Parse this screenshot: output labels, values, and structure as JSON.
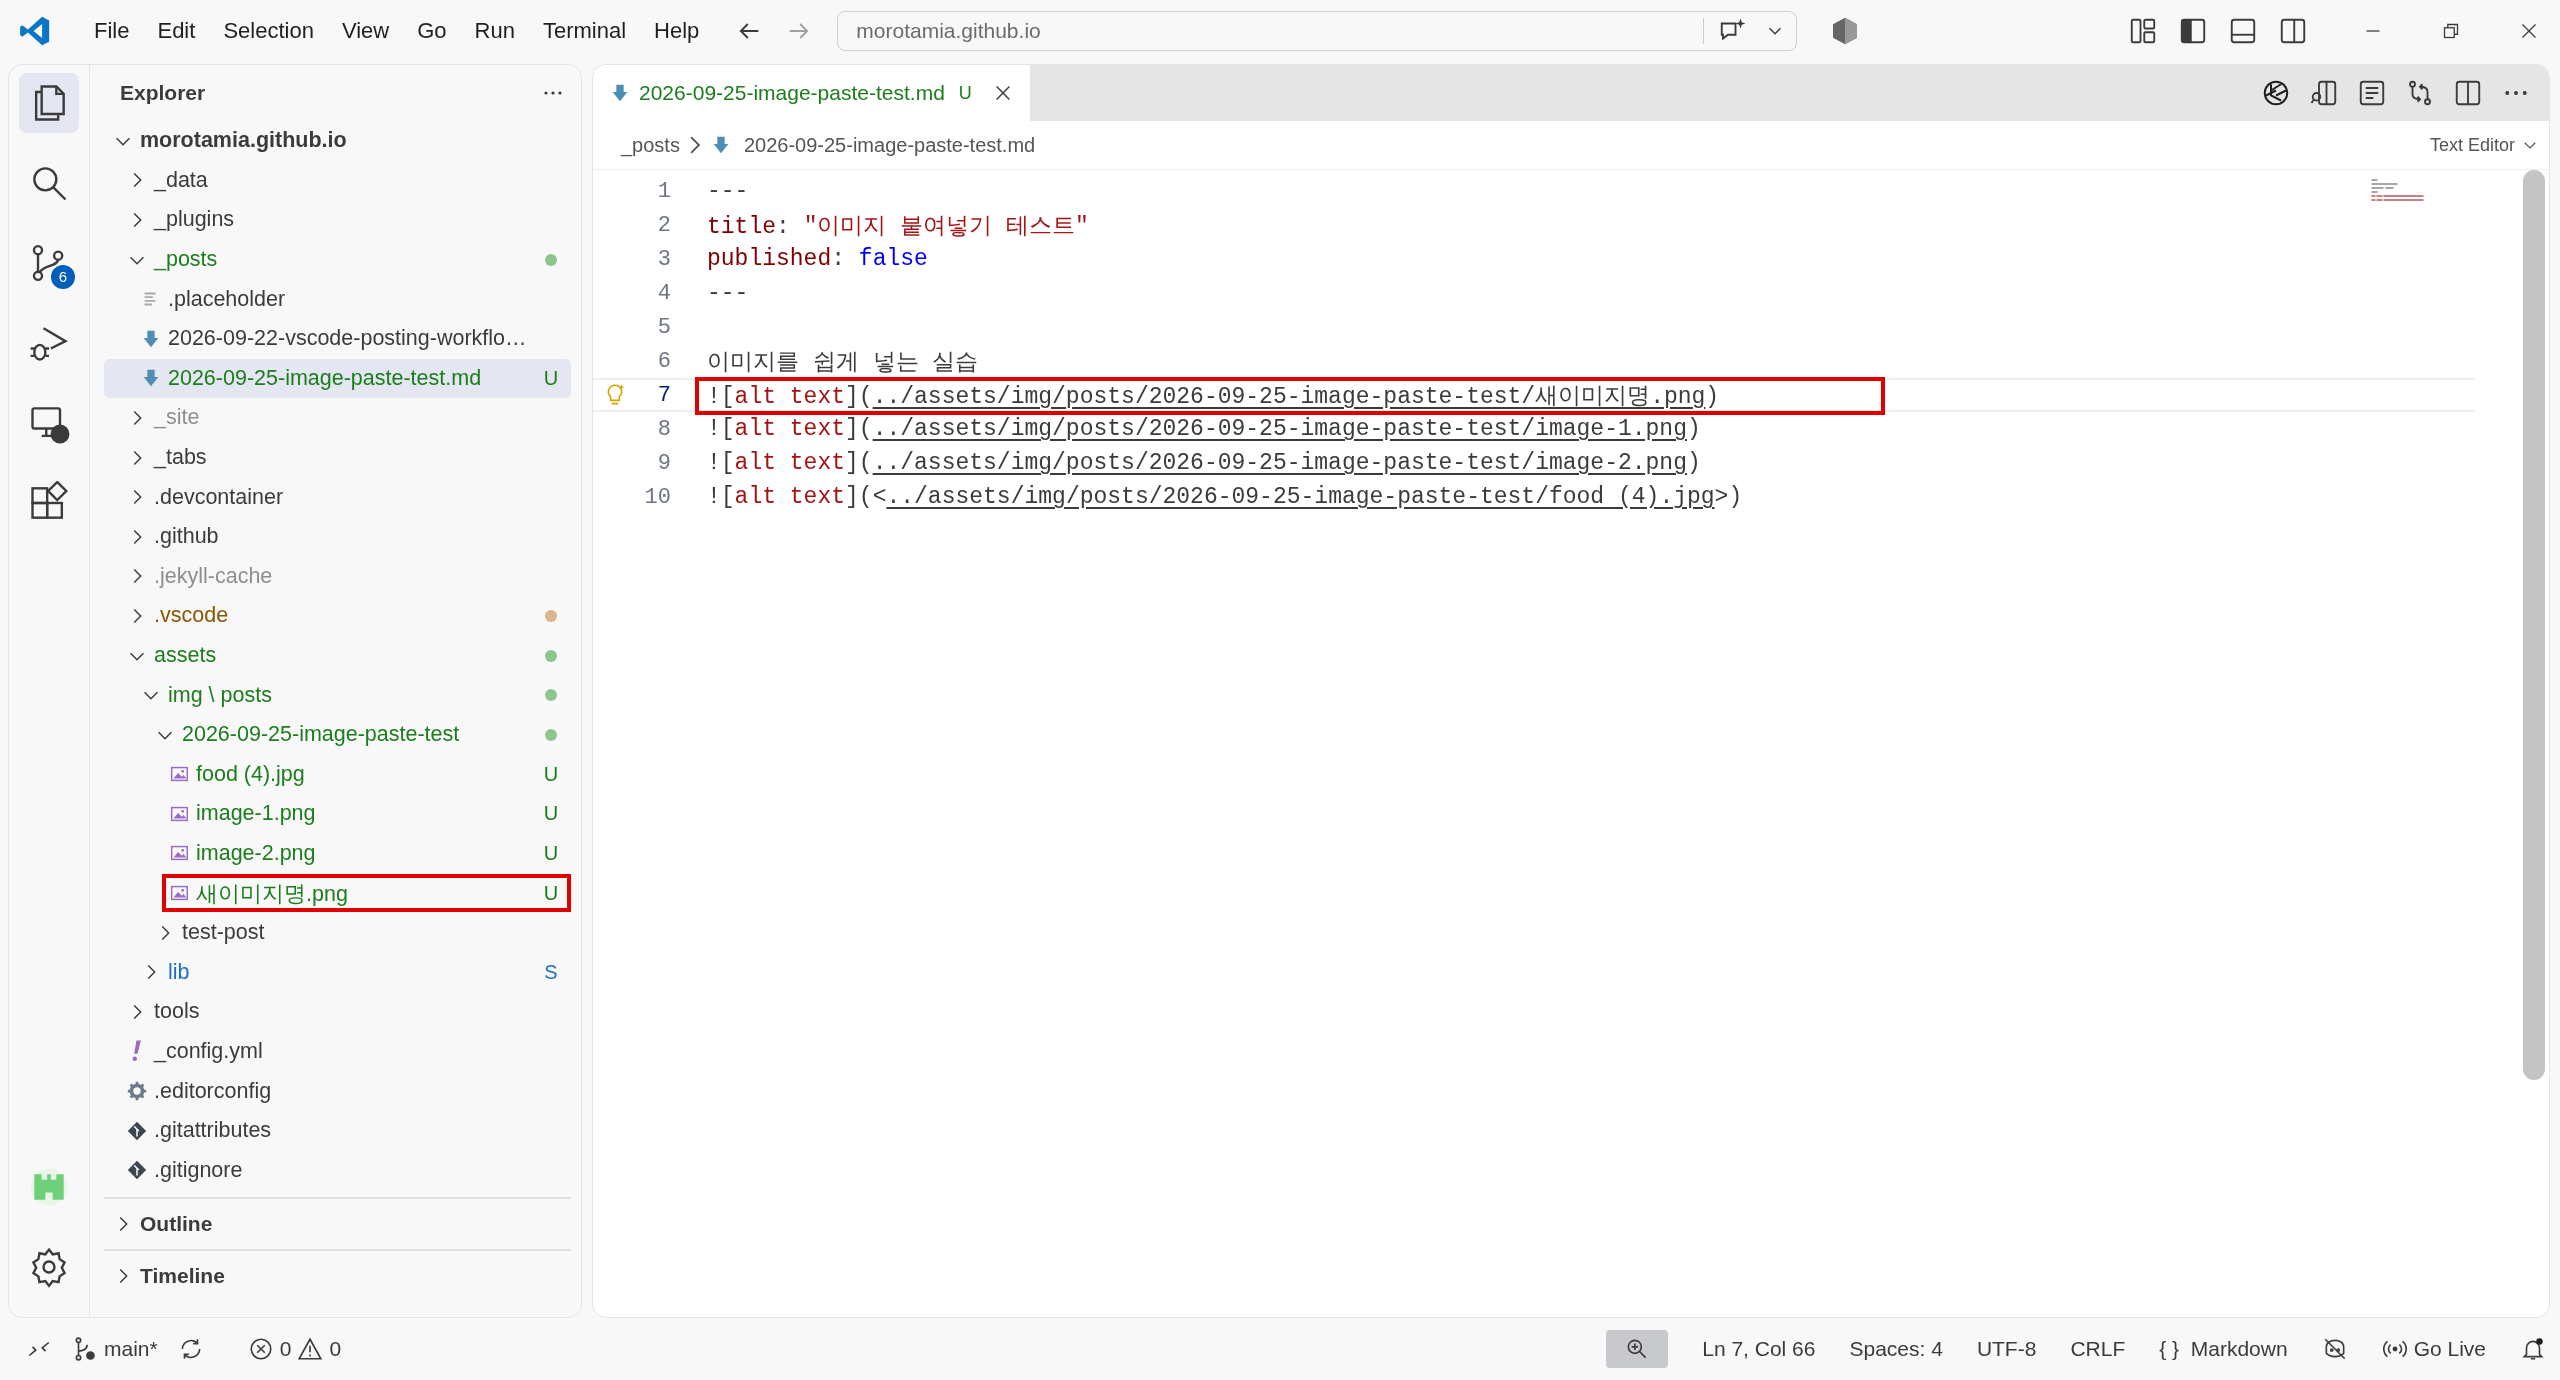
{
  "title_bar": {
    "menus": [
      "File",
      "Edit",
      "Selection",
      "View",
      "Go",
      "Run",
      "Terminal",
      "Help"
    ],
    "command_center": "morotamia.github.io"
  },
  "activity_bar": {
    "top": [
      {
        "kind": "explorer",
        "selected": true
      },
      {
        "kind": "search",
        "selected": false
      },
      {
        "kind": "source-control",
        "selected": false,
        "badge": "6"
      },
      {
        "kind": "run-debug",
        "selected": false
      },
      {
        "kind": "remote",
        "selected": false
      },
      {
        "kind": "extensions",
        "selected": false
      }
    ],
    "bottom": [
      {
        "kind": "extension-app"
      },
      {
        "kind": "settings"
      }
    ]
  },
  "explorer": {
    "title": "Explorer",
    "tree": [
      {
        "name": "morotamia.github.io",
        "kind": "folder",
        "expanded": true,
        "selected": false,
        "color": "#3b3b3b",
        "children": [
          {
            "name": "_data",
            "kind": "folder",
            "expanded": false,
            "selected": false,
            "color": "#3b3b3b"
          },
          {
            "name": "_plugins",
            "kind": "folder",
            "expanded": false,
            "selected": false,
            "color": "#3b3b3b"
          },
          {
            "name": "_posts",
            "kind": "folder",
            "expanded": true,
            "selected": false,
            "color": "#1b7d1b",
            "dot": {
              "color": "#8cc68c"
            },
            "children": [
              {
                "name": ".placeholder",
                "kind": "text",
                "selected": false,
                "color": "#3b3b3b"
              },
              {
                "name": "2026-09-22-vscode-posting-workflo…",
                "kind": "markdown",
                "selected": false,
                "color": "#3b3b3b"
              },
              {
                "name": "2026-09-25-image-paste-test.md",
                "kind": "markdown",
                "selected": true,
                "color": "#1b7d1b",
                "badge": "U"
              }
            ]
          },
          {
            "name": "_site",
            "kind": "folder",
            "expanded": false,
            "selected": false,
            "color": "#8e8e90"
          },
          {
            "name": "_tabs",
            "kind": "folder",
            "expanded": false,
            "selected": false,
            "color": "#3b3b3b"
          },
          {
            "name": ".devcontainer",
            "kind": "folder",
            "expanded": false,
            "selected": false,
            "color": "#3b3b3b"
          },
          {
            "name": ".github",
            "kind": "folder",
            "expanded": false,
            "selected": false,
            "color": "#3b3b3b"
          },
          {
            "name": ".jekyll-cache",
            "kind": "folder",
            "expanded": false,
            "selected": false,
            "color": "#8e8e90"
          },
          {
            "name": ".vscode",
            "kind": "folder",
            "expanded": false,
            "selected": false,
            "color": "#895503",
            "dot": {
              "color": "#d9b48c"
            }
          },
          {
            "name": "assets",
            "kind": "folder",
            "expanded": true,
            "selected": false,
            "color": "#1b7d1b",
            "dot": {
              "color": "#8cc68c"
            },
            "children": [
              {
                "name": "img \\ posts",
                "kind": "folder",
                "expanded": true,
                "selected": false,
                "color": "#1b7d1b",
                "dot": {
                  "color": "#8cc68c"
                },
                "children": [
                  {
                    "name": "2026-09-25-image-paste-test",
                    "kind": "folder",
                    "expanded": true,
                    "selected": false,
                    "color": "#1b7d1b",
                    "dot": {
                      "color": "#8cc68c"
                    },
                    "children": [
                      {
                        "name": "food (4).jpg",
                        "kind": "image",
                        "selected": false,
                        "color": "#1b7d1b",
                        "badge": "U"
                      },
                      {
                        "name": "image-1.png",
                        "kind": "image",
                        "selected": false,
                        "color": "#1b7d1b",
                        "badge": "U"
                      },
                      {
                        "name": "image-2.png",
                        "kind": "image",
                        "selected": false,
                        "color": "#1b7d1b",
                        "badge": "U"
                      },
                      {
                        "name": "새이미지명.png",
                        "kind": "image",
                        "selected": false,
                        "color": "#1b7d1b",
                        "badge": "U",
                        "annotated": true
                      }
                    ]
                  },
                  {
                    "name": "test-post",
                    "kind": "folder",
                    "expanded": false,
                    "selected": false,
                    "color": "#3b3b3b"
                  }
                ]
              },
              {
                "name": "lib",
                "kind": "folder",
                "expanded": false,
                "selected": false,
                "color": "#1a6fc4",
                "badge": "S"
              }
            ]
          },
          {
            "name": "tools",
            "kind": "folder",
            "expanded": false,
            "selected": false,
            "color": "#3b3b3b"
          },
          {
            "name": "_config.yml",
            "kind": "yaml",
            "selected": false,
            "color": "#3b3b3b"
          },
          {
            "name": ".editorconfig",
            "kind": "gear",
            "selected": false,
            "color": "#3b3b3b"
          },
          {
            "name": ".gitattributes",
            "kind": "git",
            "selected": false,
            "color": "#3b3b3b"
          },
          {
            "name": ".gitignore",
            "kind": "git",
            "selected": false,
            "color": "#3b3b3b"
          }
        ]
      }
    ],
    "sections": [
      {
        "label": "Outline",
        "expanded": false
      },
      {
        "label": "Timeline",
        "expanded": false
      }
    ]
  },
  "editor": {
    "tabs": [
      {
        "label": "2026-09-25-image-paste-test.md",
        "badge": "U",
        "selected": true,
        "color": "#1b7d1b"
      }
    ],
    "breadcrumb": [
      {
        "label": "_posts",
        "kind": "folder"
      },
      {
        "label": "2026-09-25-image-paste-test.md",
        "kind": "markdown"
      }
    ],
    "view_mode": "Text Editor",
    "lines": [
      {
        "number": "1",
        "segments": [
          {
            "text": "---",
            "kind": "punct"
          }
        ]
      },
      {
        "number": "2",
        "segments": [
          {
            "text": "title",
            "kind": "key"
          },
          {
            "text": ": ",
            "kind": "punct"
          },
          {
            "text": "\"이미지 붙여넣기 테스트\"",
            "kind": "string"
          }
        ]
      },
      {
        "number": "3",
        "segments": [
          {
            "text": "published",
            "kind": "key"
          },
          {
            "text": ": ",
            "kind": "punct"
          },
          {
            "text": "false",
            "kind": "bool"
          }
        ]
      },
      {
        "number": "4",
        "segments": [
          {
            "text": "---",
            "kind": "punct"
          }
        ]
      },
      {
        "number": "5"
      },
      {
        "number": "6",
        "segments": [
          {
            "text": "이미지를 쉽게 넣는 실습",
            "kind": "plain"
          }
        ]
      },
      {
        "number": "7",
        "active": true,
        "annotated": true,
        "segments": [
          {
            "text": "![",
            "kind": "punct"
          },
          {
            "text": "alt text",
            "kind": "alt"
          },
          {
            "text": "](",
            "kind": "punct"
          },
          {
            "text": "../assets/img/posts/2026-09-25-image-paste-test/새이미지명.png",
            "kind": "link"
          },
          {
            "text": ")",
            "kind": "punct"
          }
        ]
      },
      {
        "number": "8",
        "segments": [
          {
            "text": "![",
            "kind": "punct"
          },
          {
            "text": "alt text",
            "kind": "alt"
          },
          {
            "text": "](",
            "kind": "punct"
          },
          {
            "text": "../assets/img/posts/2026-09-25-image-paste-test/image-1.png",
            "kind": "link"
          },
          {
            "text": ")",
            "kind": "punct"
          }
        ]
      },
      {
        "number": "9",
        "segments": [
          {
            "text": "![",
            "kind": "punct"
          },
          {
            "text": "alt text",
            "kind": "alt"
          },
          {
            "text": "](",
            "kind": "punct"
          },
          {
            "text": "../assets/img/posts/2026-09-25-image-paste-test/image-2.png",
            "kind": "link"
          },
          {
            "text": ")",
            "kind": "punct"
          }
        ]
      },
      {
        "number": "10",
        "segments": [
          {
            "text": "![",
            "kind": "punct"
          },
          {
            "text": "alt text",
            "kind": "alt"
          },
          {
            "text": "](<",
            "kind": "punct"
          },
          {
            "text": "../assets/img/posts/2026-09-25-image-paste-test/food (4).jpg",
            "kind": "link"
          },
          {
            "text": ">)",
            "kind": "punct"
          }
        ]
      }
    ]
  },
  "status_bar": {
    "branch": "main*",
    "errors": "0",
    "warnings": "0",
    "right": [
      {
        "kind": "zoom"
      },
      {
        "kind": "text",
        "label": "Ln 7, Col 66"
      },
      {
        "kind": "text",
        "label": "Spaces: 4"
      },
      {
        "kind": "text",
        "label": "UTF-8"
      },
      {
        "kind": "text",
        "label": "CRLF"
      },
      {
        "kind": "language",
        "glyph": "{ }",
        "label": "Markdown"
      },
      {
        "kind": "copilot"
      },
      {
        "kind": "live",
        "label": "Go Live"
      },
      {
        "kind": "bell"
      }
    ]
  }
}
